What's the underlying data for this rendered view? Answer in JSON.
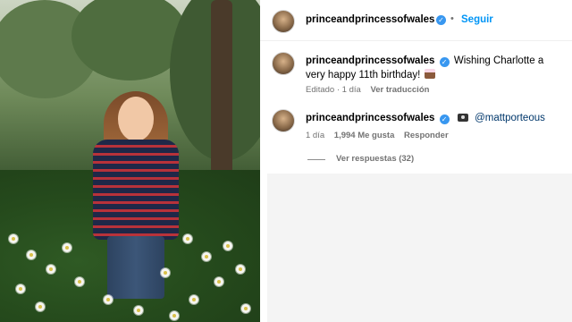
{
  "post": {
    "username": "princeandprincessofwales",
    "follow_label": "Seguir",
    "separator": "•"
  },
  "caption": {
    "username": "princeandprincessofwales",
    "text": "Wishing Charlotte a very happy 11th birthday!",
    "edited": "Editado · 1 día",
    "translate": "Ver traducción"
  },
  "comment": {
    "username": "princeandprincessofwales",
    "mention": "@mattporteous",
    "time": "1 día",
    "likes": "1,994 Me gusta",
    "reply": "Responder",
    "view_replies": "Ver respuestas (32)"
  },
  "colors": {
    "accent": "#0095f6",
    "verified": "#3897f0",
    "muted": "#737373"
  },
  "icons": [
    "verified-badge-icon",
    "birthday-cake-icon",
    "camera-icon",
    "avatar"
  ]
}
